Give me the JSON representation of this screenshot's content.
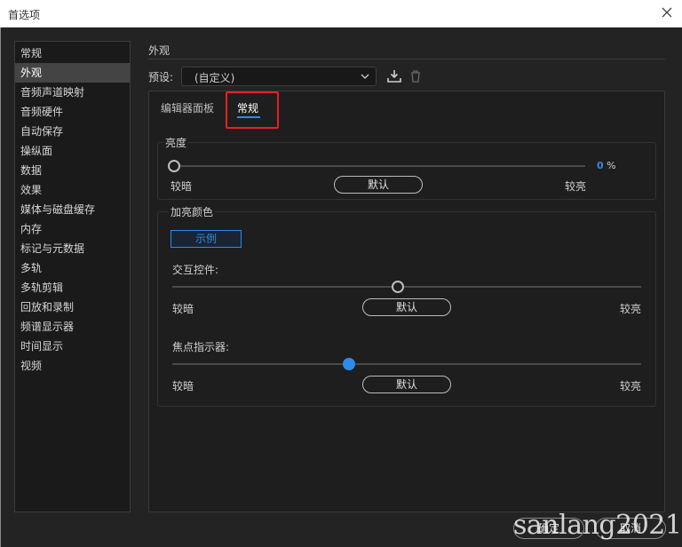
{
  "window": {
    "title": "首选项"
  },
  "sidebar": {
    "items": [
      {
        "label": "常规"
      },
      {
        "label": "外观",
        "selected": true
      },
      {
        "label": "音频声道映射"
      },
      {
        "label": "音频硬件"
      },
      {
        "label": "自动保存"
      },
      {
        "label": "操纵面"
      },
      {
        "label": "数据"
      },
      {
        "label": "效果"
      },
      {
        "label": "媒体与磁盘缓存"
      },
      {
        "label": "内存"
      },
      {
        "label": "标记与元数据"
      },
      {
        "label": "多轨"
      },
      {
        "label": "多轨剪辑"
      },
      {
        "label": "回放和录制"
      },
      {
        "label": "频谱显示器"
      },
      {
        "label": "时间显示"
      },
      {
        "label": "视频"
      }
    ]
  },
  "main": {
    "section_title": "外观",
    "preset": {
      "label": "预设:",
      "value": "(自定义)"
    },
    "tabs": [
      {
        "label": "编辑器面板"
      },
      {
        "label": "常规",
        "active": true
      }
    ],
    "brightness": {
      "title": "亮度",
      "value": "0",
      "unit": "%",
      "min_label": "较暗",
      "max_label": "较亮",
      "default_label": "默认",
      "level": 0.0
    },
    "highlight": {
      "title": "加亮颜色",
      "sample_label": "示例",
      "interactive": {
        "label": "交互控件:",
        "min_label": "较暗",
        "max_label": "较亮",
        "default_label": "默认",
        "level": 0.5
      },
      "focus": {
        "label": "焦点指示器:",
        "min_label": "较暗",
        "max_label": "较亮",
        "default_label": "默认",
        "level": 0.38
      }
    }
  },
  "footer": {
    "ok_label": "确定",
    "cancel_label": "取消"
  },
  "watermark": "sanlang2021",
  "colors": {
    "accent": "#2d8ceb",
    "highlight_box": "#e62020",
    "background": "#232323"
  }
}
